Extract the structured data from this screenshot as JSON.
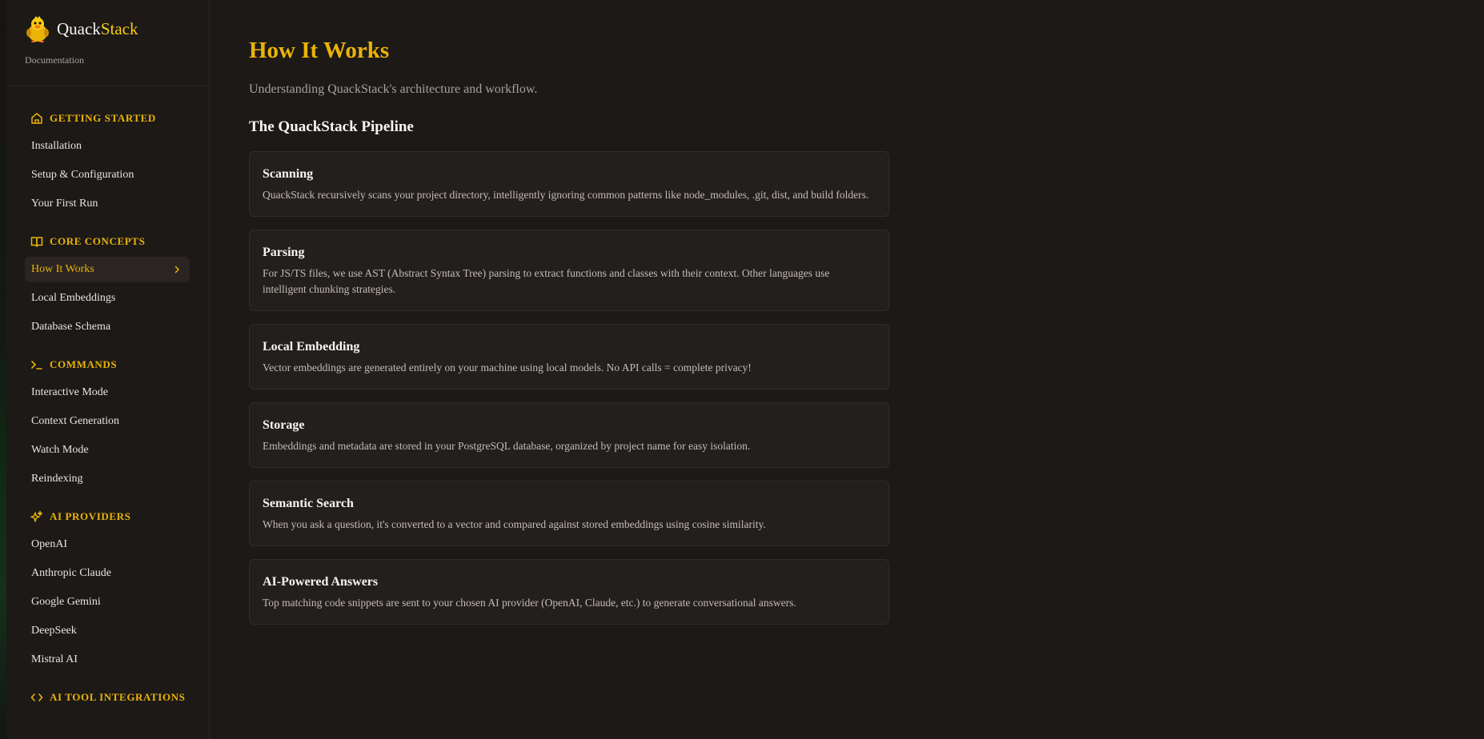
{
  "brand": {
    "name_part1": "Quack",
    "name_part2": "Stack",
    "subtitle": "Documentation"
  },
  "colors": {
    "accent": "#eab308",
    "background": "#1c1917",
    "card": "#231f1d",
    "active_item_bg": "#2a2522"
  },
  "sidebar": {
    "sections": [
      {
        "title": "GETTING STARTED",
        "icon": "home-icon",
        "items": [
          {
            "label": "Installation"
          },
          {
            "label": "Setup & Configuration"
          },
          {
            "label": "Your First Run"
          }
        ]
      },
      {
        "title": "CORE CONCEPTS",
        "icon": "book-open-icon",
        "items": [
          {
            "label": "How It Works",
            "active": true
          },
          {
            "label": "Local Embeddings"
          },
          {
            "label": "Database Schema"
          }
        ]
      },
      {
        "title": "COMMANDS",
        "icon": "terminal-icon",
        "items": [
          {
            "label": "Interactive Mode"
          },
          {
            "label": "Context Generation"
          },
          {
            "label": "Watch Mode"
          },
          {
            "label": "Reindexing"
          }
        ]
      },
      {
        "title": "AI PROVIDERS",
        "icon": "sparkles-icon",
        "items": [
          {
            "label": "OpenAI"
          },
          {
            "label": "Anthropic Claude"
          },
          {
            "label": "Google Gemini"
          },
          {
            "label": "DeepSeek"
          },
          {
            "label": "Mistral AI"
          }
        ]
      },
      {
        "title": "AI TOOL INTEGRATIONS",
        "icon": "code-icon",
        "items": []
      }
    ]
  },
  "main": {
    "title": "How It Works",
    "subtitle": "Understanding QuackStack's architecture and workflow.",
    "section_heading": "The QuackStack Pipeline",
    "cards": [
      {
        "title": "Scanning",
        "description": "QuackStack recursively scans your project directory, intelligently ignoring common patterns like node_modules, .git, dist, and build folders."
      },
      {
        "title": "Parsing",
        "description": "For JS/TS files, we use AST (Abstract Syntax Tree) parsing to extract functions and classes with their context. Other languages use intelligent chunking strategies."
      },
      {
        "title": "Local Embedding",
        "description": "Vector embeddings are generated entirely on your machine using local models. No API calls = complete privacy!"
      },
      {
        "title": "Storage",
        "description": "Embeddings and metadata are stored in your PostgreSQL database, organized by project name for easy isolation."
      },
      {
        "title": "Semantic Search",
        "description": "When you ask a question, it's converted to a vector and compared against stored embeddings using cosine similarity."
      },
      {
        "title": "AI-Powered Answers",
        "description": "Top matching code snippets are sent to your chosen AI provider (OpenAI, Claude, etc.) to generate conversational answers."
      }
    ]
  }
}
